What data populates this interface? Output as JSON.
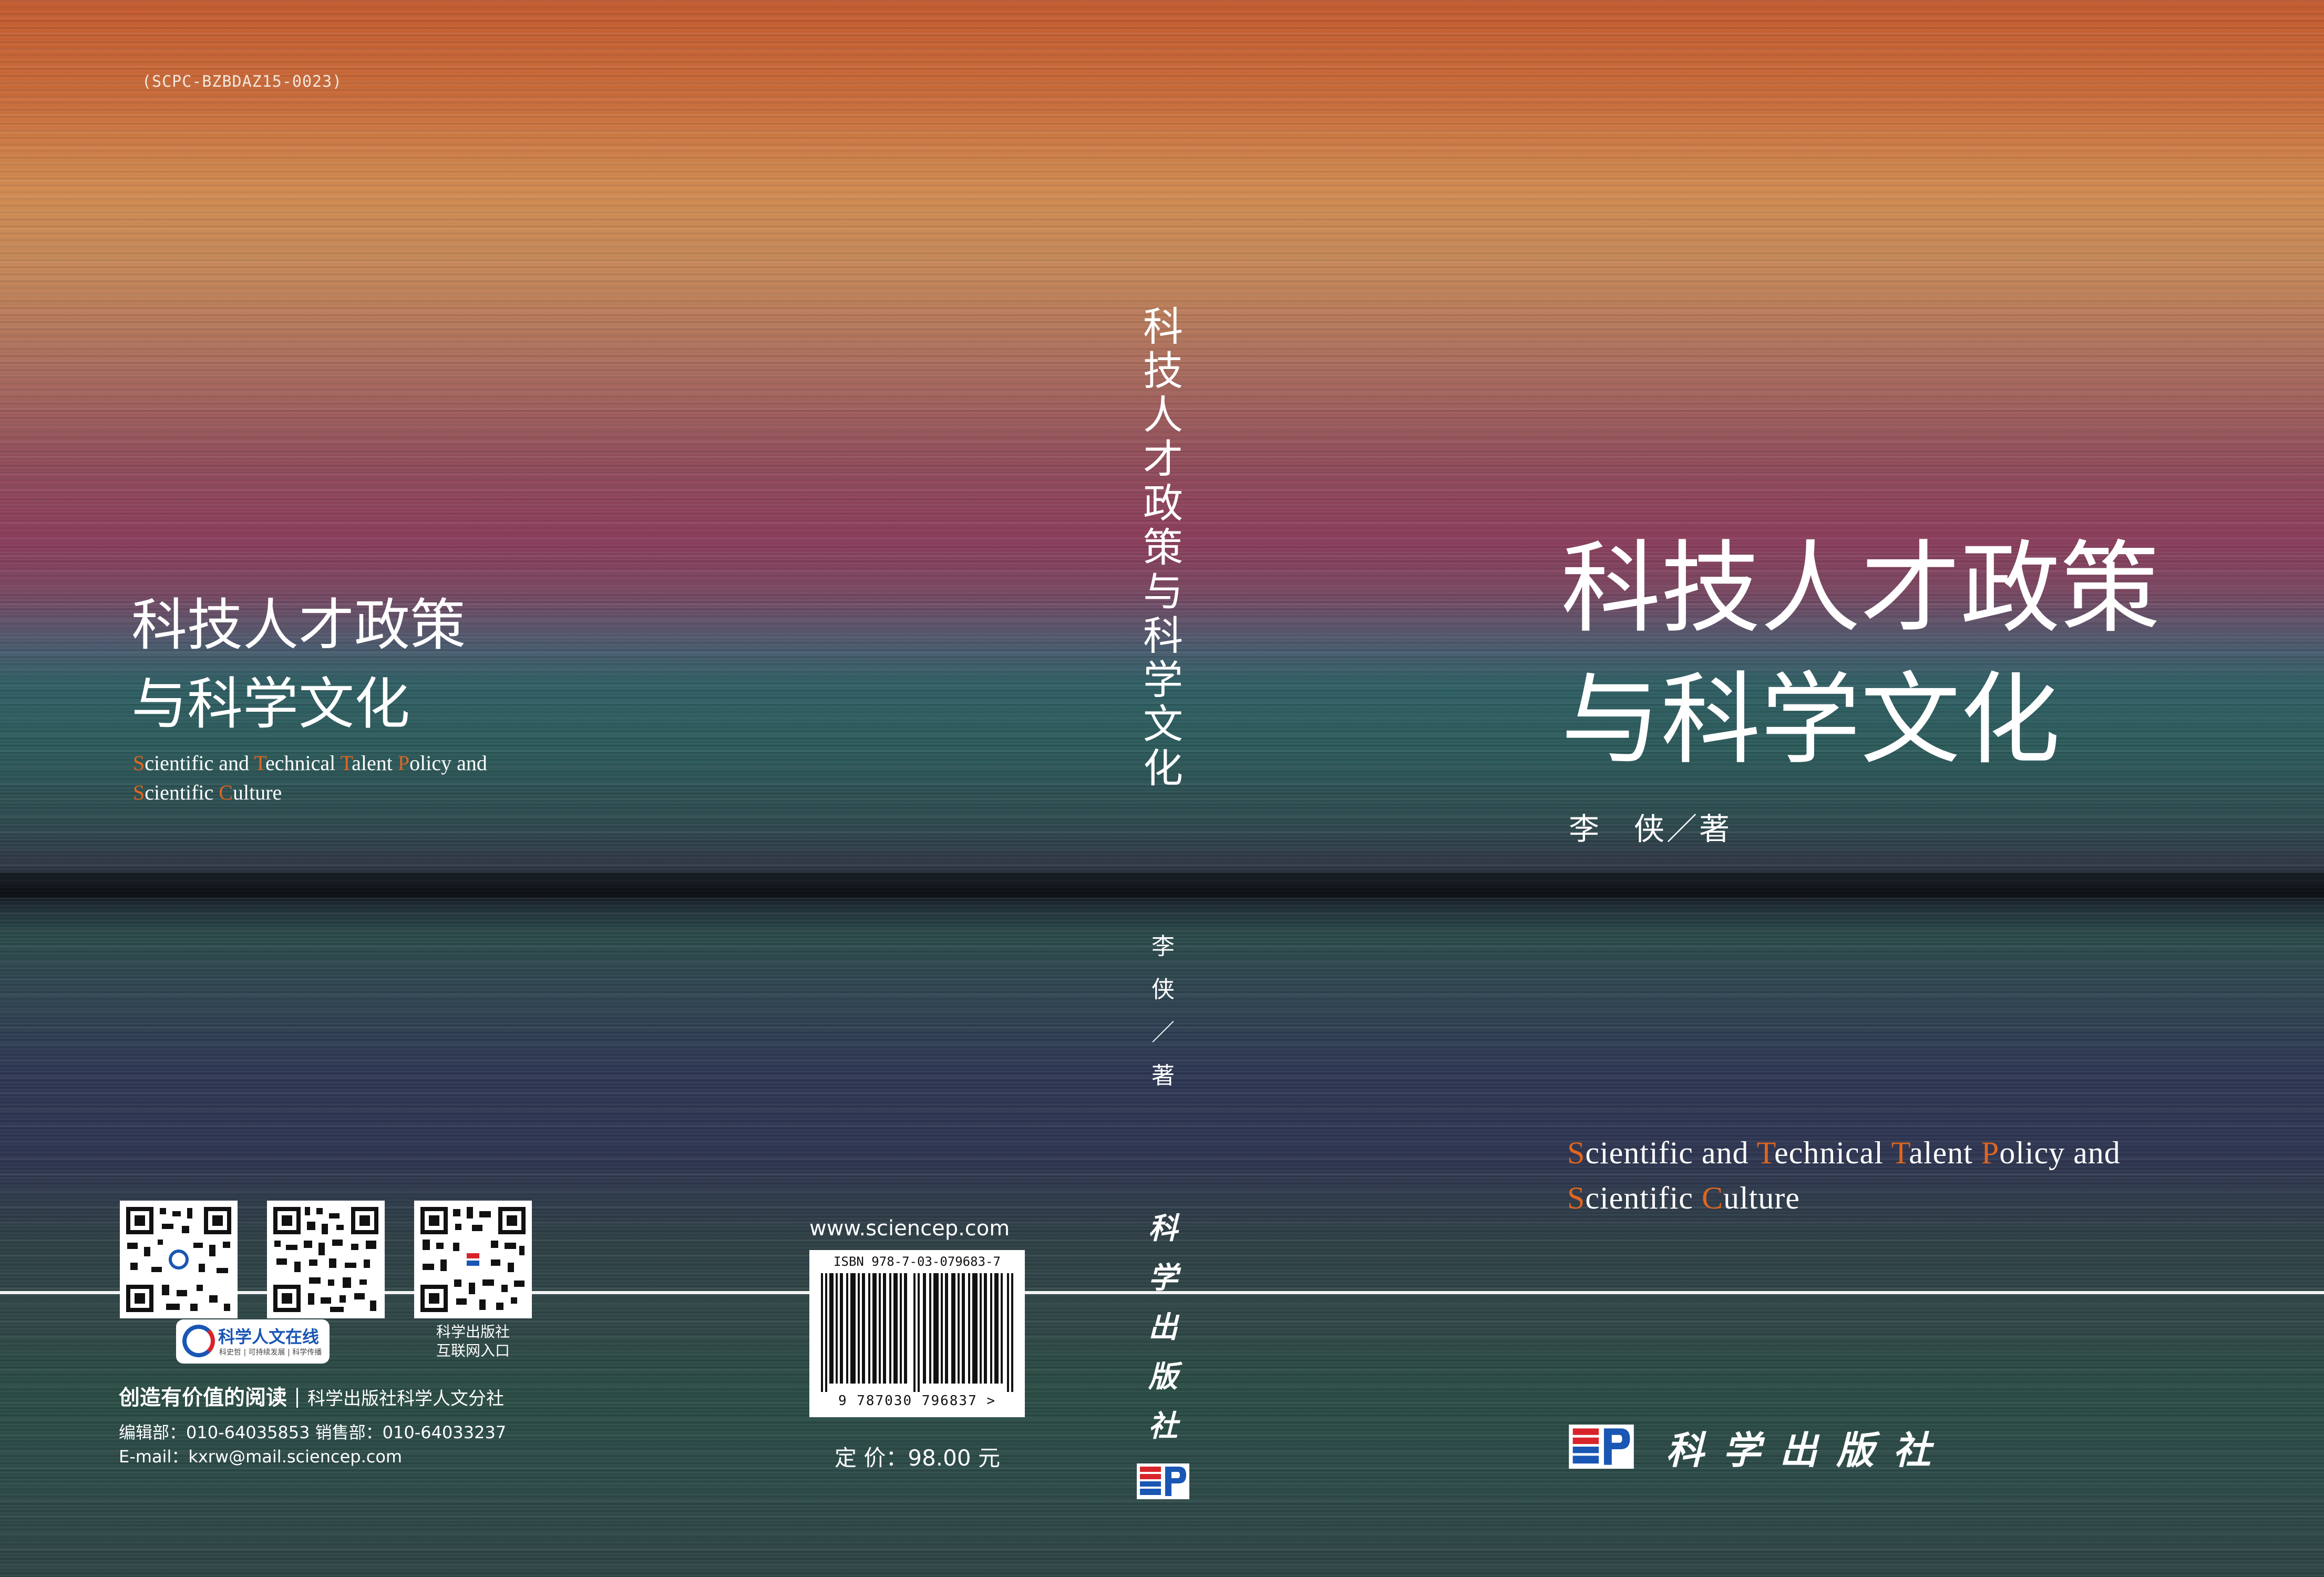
{
  "code": "(SCPC-BZBDAZ15-0023)",
  "title": {
    "line1": "科技人才政策",
    "line2": "与科学文化",
    "spine": "科技人才政策与科学文化"
  },
  "english_title": {
    "line1": {
      "c1": "S",
      "w1": "cientific and ",
      "c2": "T",
      "w2": "echnical ",
      "c3": "T",
      "w3": "alent ",
      "c4": "P",
      "w4": "olicy and"
    },
    "line2": {
      "c1": "S",
      "w1": "cientific ",
      "c2": "C",
      "w2": "ulture"
    }
  },
  "author": {
    "front": "李　侠／著",
    "spine": "李侠／著"
  },
  "publisher": {
    "name": "科学出版社",
    "website": "www.sciencep.com"
  },
  "qr_section": {
    "logo_main": "科学人文在线",
    "logo_sub": "科史哲 | 可持续发展 | 科学传播",
    "caption_line1": "科学出版社",
    "caption_line2": "互联网入口"
  },
  "slogan": {
    "main": "创造有价值的阅读",
    "publisher": "科学出版社科学人文分社"
  },
  "contacts": {
    "phones": "编辑部：010-64035853  销售部：010-64033237",
    "email": "E-mail：kxrw@mail.sciencep.com"
  },
  "isbn": {
    "top": "ISBN 978-7-03-079683-7",
    "bottom": "9 787030 796837 >"
  },
  "price": "定 价：98.00 元",
  "colors": {
    "highlight": "#e0661f",
    "logo_red": "#d8232a",
    "logo_blue": "#1a56b3"
  }
}
